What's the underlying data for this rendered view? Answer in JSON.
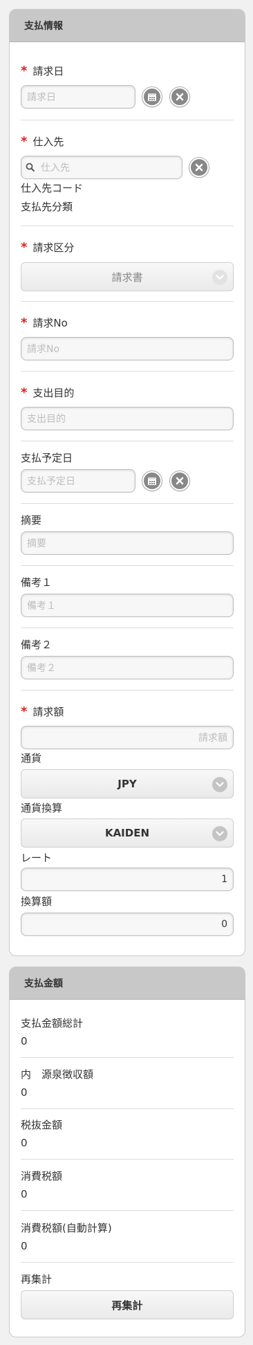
{
  "payment_info": {
    "header": "支払情報",
    "seikyu_date": {
      "label": "請求日",
      "placeholder": "請求日"
    },
    "shiiresaki": {
      "label": "仕入先",
      "placeholder": "仕入先",
      "code_label": "仕入先コード",
      "category_label": "支払先分類"
    },
    "seikyu_kubun": {
      "label": "請求区分",
      "selected": "請求書"
    },
    "seikyu_no": {
      "label": "請求No",
      "placeholder": "請求No"
    },
    "shishutsu_mokuteki": {
      "label": "支出目的",
      "placeholder": "支出目的"
    },
    "shiharai_yotei": {
      "label": "支払予定日",
      "placeholder": "支払予定日"
    },
    "tekiyo": {
      "label": "摘要",
      "placeholder": "摘要"
    },
    "biko1": {
      "label": "備考１",
      "placeholder": "備考１"
    },
    "biko2": {
      "label": "備考２",
      "placeholder": "備考２"
    },
    "seikyu_gaku": {
      "label": "請求額",
      "placeholder": "請求額"
    },
    "tsuka": {
      "label": "通貨",
      "selected": "JPY"
    },
    "tsuka_kansan": {
      "label": "通貨換算",
      "selected": "KAIDEN"
    },
    "rate": {
      "label": "レート",
      "value": "1"
    },
    "kansan_gaku": {
      "label": "換算額",
      "value": "0"
    }
  },
  "payment_amount": {
    "header": "支払金額",
    "items": [
      {
        "label": "支払金額総計",
        "value": "0"
      },
      {
        "label": "内　源泉徴収額",
        "value": "0"
      },
      {
        "label": "税抜金額",
        "value": "0"
      },
      {
        "label": "消費税額",
        "value": "0"
      },
      {
        "label": "消費税額(自動計算)",
        "value": "0"
      }
    ],
    "recalc_label": "再集計",
    "recalc_button": "再集計"
  }
}
